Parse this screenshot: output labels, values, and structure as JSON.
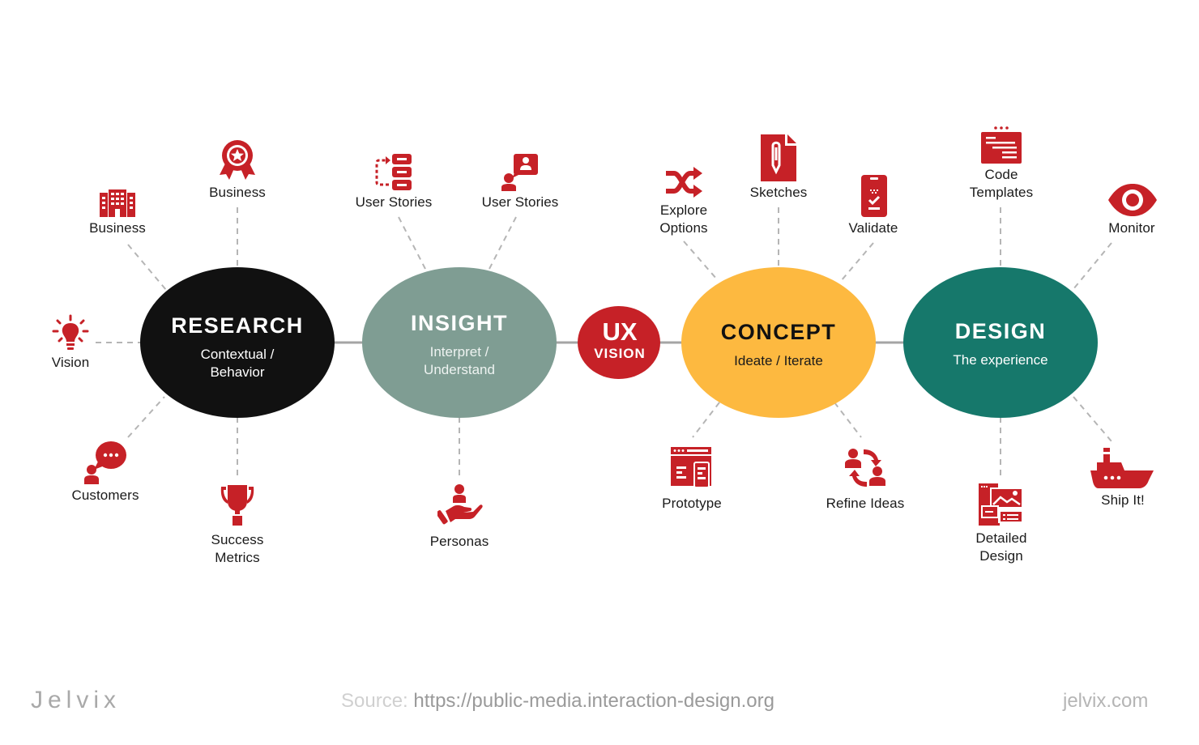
{
  "colors": {
    "accent_red": "#c62127",
    "research": "#111111",
    "insight": "#7f9d93",
    "ux_vision": "#c62127",
    "concept": "#fdb940",
    "design": "#16786b",
    "connector": "#a5a5a5",
    "dashed": "#b5b5b5",
    "text": "#1a1a1a"
  },
  "center": {
    "ux_title": "UX",
    "ux_subtitle": "VISION"
  },
  "stages": [
    {
      "id": "research",
      "title": "RESEARCH",
      "subtitle": "Contextual /\nBehavior"
    },
    {
      "id": "insight",
      "title": "INSIGHT",
      "subtitle": "Interpret /\nUnderstand"
    },
    {
      "id": "concept",
      "title": "CONCEPT",
      "subtitle": "Ideate / Iterate"
    },
    {
      "id": "design",
      "title": "DESIGN",
      "subtitle": "The experience"
    }
  ],
  "nodes": {
    "research": [
      {
        "label": "Business",
        "icon": "building-icon"
      },
      {
        "label": "Business",
        "icon": "award-ribbon-icon"
      },
      {
        "label": "Vision",
        "icon": "lightbulb-icon"
      },
      {
        "label": "Customers",
        "icon": "chat-user-icon"
      },
      {
        "label": "Success\nMetrics",
        "icon": "trophy-icon"
      }
    ],
    "insight": [
      {
        "label": "User Stories",
        "icon": "flow-steps-icon"
      },
      {
        "label": "User Stories",
        "icon": "user-speech-icon"
      },
      {
        "label": "Personas",
        "icon": "hand-user-icon"
      }
    ],
    "concept": [
      {
        "label": "Explore\nOptions",
        "icon": "shuffle-icon"
      },
      {
        "label": "Sketches",
        "icon": "pencil-document-icon"
      },
      {
        "label": "Validate",
        "icon": "clipboard-check-icon"
      },
      {
        "label": "Prototype",
        "icon": "browser-layout-icon"
      },
      {
        "label": "Refine Ideas",
        "icon": "users-cycle-icon"
      }
    ],
    "design": [
      {
        "label": "Code\nTemplates",
        "icon": "code-window-icon"
      },
      {
        "label": "Monitor",
        "icon": "eye-icon"
      },
      {
        "label": "Detailed\nDesign",
        "icon": "layout-image-icon"
      },
      {
        "label": "Ship It!",
        "icon": "ship-icon"
      }
    ]
  },
  "footer": {
    "logo": "Jelvix",
    "source_key": "Source:",
    "source_url": "https://public-media.interaction-design.org",
    "site": "jelvix.com"
  }
}
